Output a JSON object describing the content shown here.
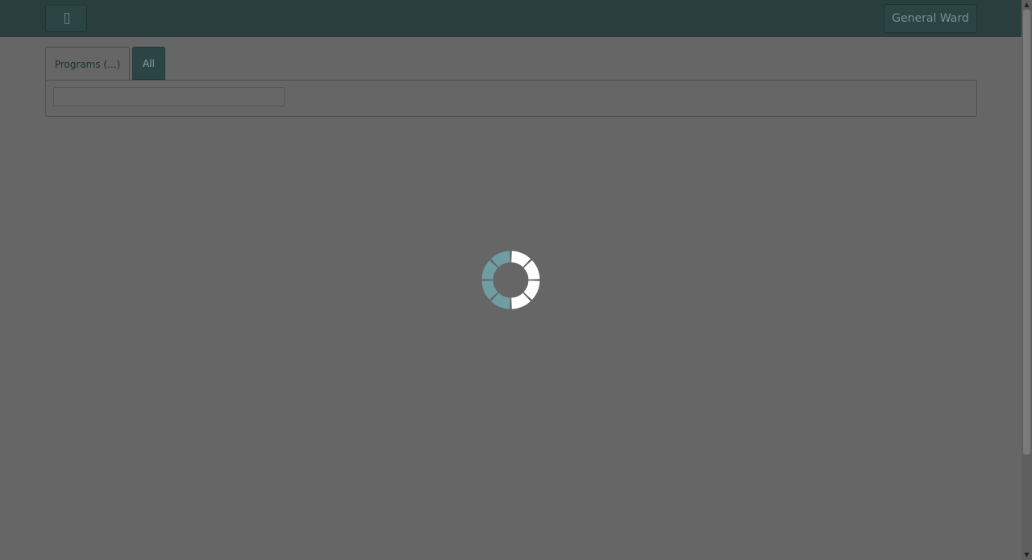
{
  "header": {
    "menu_icon": "menu-icon",
    "ward_label": "General Ward"
  },
  "tabs": [
    {
      "label": "Programs (...)"
    },
    {
      "label": "All"
    }
  ],
  "search": {
    "value": "",
    "placeholder": ""
  },
  "loading": {
    "icon": "loading-spinner-icon",
    "active_color": "#ffffff",
    "inactive_color": "#6e9ea3"
  },
  "scrollbar": {
    "up_icon": "▲",
    "down_icon": "▼"
  },
  "colors": {
    "topbar": "#2a3e3e",
    "overlay": "#666666",
    "tab_active": "#2b4545"
  }
}
